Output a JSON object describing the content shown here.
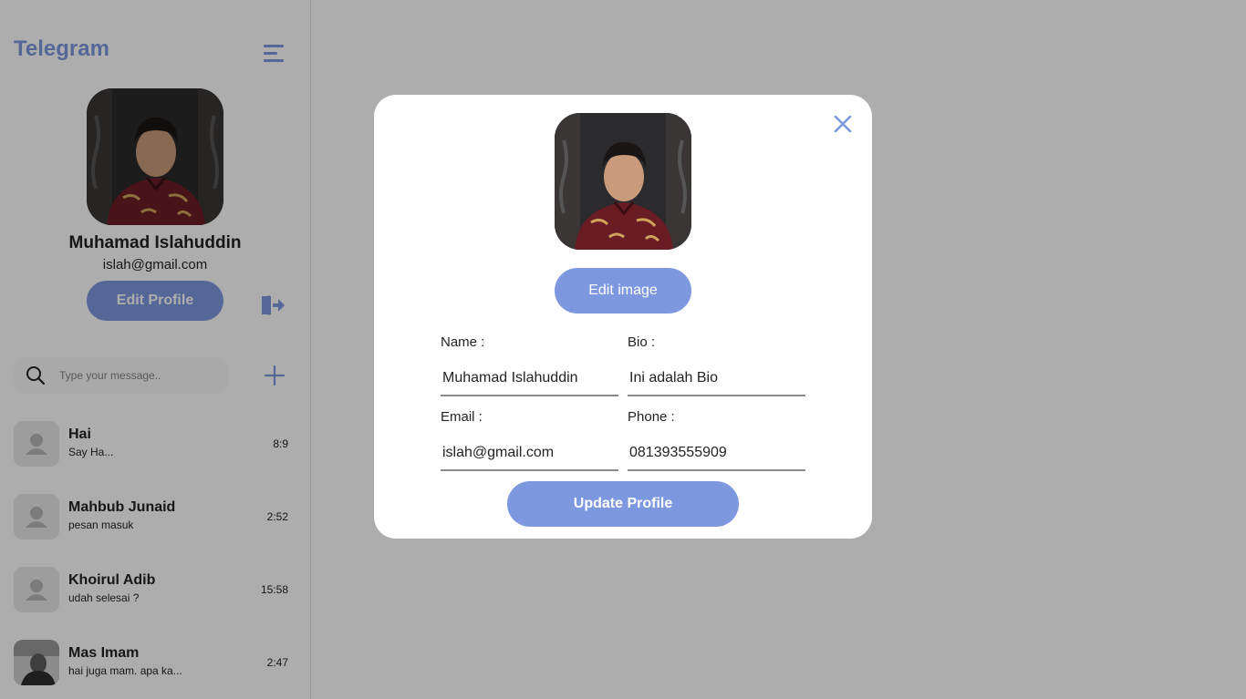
{
  "colors": {
    "accent": "#7e98df",
    "overlay": "rgba(0,0,0,0.32)",
    "avatar_placeholder": "#e8e8e8"
  },
  "sidebar": {
    "brand": "Telegram",
    "menu_icon": "menu-lines-icon",
    "profile": {
      "name": "Muhamad Islahuddin",
      "email": "islah@gmail.com",
      "edit_button": "Edit Profile",
      "logout_icon": "logout-icon"
    },
    "search": {
      "placeholder": "Type your message.."
    },
    "add_icon": "plus-icon",
    "chats": [
      {
        "name": "Hai",
        "preview": "Say Ha...",
        "time": "8:9",
        "avatar": "default-user-icon"
      },
      {
        "name": "Mahbub Junaid",
        "preview": "pesan masuk",
        "time": "2:52",
        "avatar": "default-user-icon"
      },
      {
        "name": "Khoirul Adib",
        "preview": "udah selesai ?",
        "time": "15:58",
        "avatar": "default-user-icon"
      },
      {
        "name": "Mas Imam",
        "preview": "hai juga mam. apa ka...",
        "time": "2:47",
        "avatar": "photo"
      }
    ]
  },
  "modal": {
    "edit_image_button": "Edit image",
    "name_label": "Name :",
    "name_value": "Muhamad Islahuddin",
    "bio_label": "Bio :",
    "bio_value": "Ini adalah Bio",
    "email_label": "Email :",
    "email_value": "islah@gmail.com",
    "phone_label": "Phone :",
    "phone_value": "081393555909",
    "update_button": "Update Profile"
  }
}
